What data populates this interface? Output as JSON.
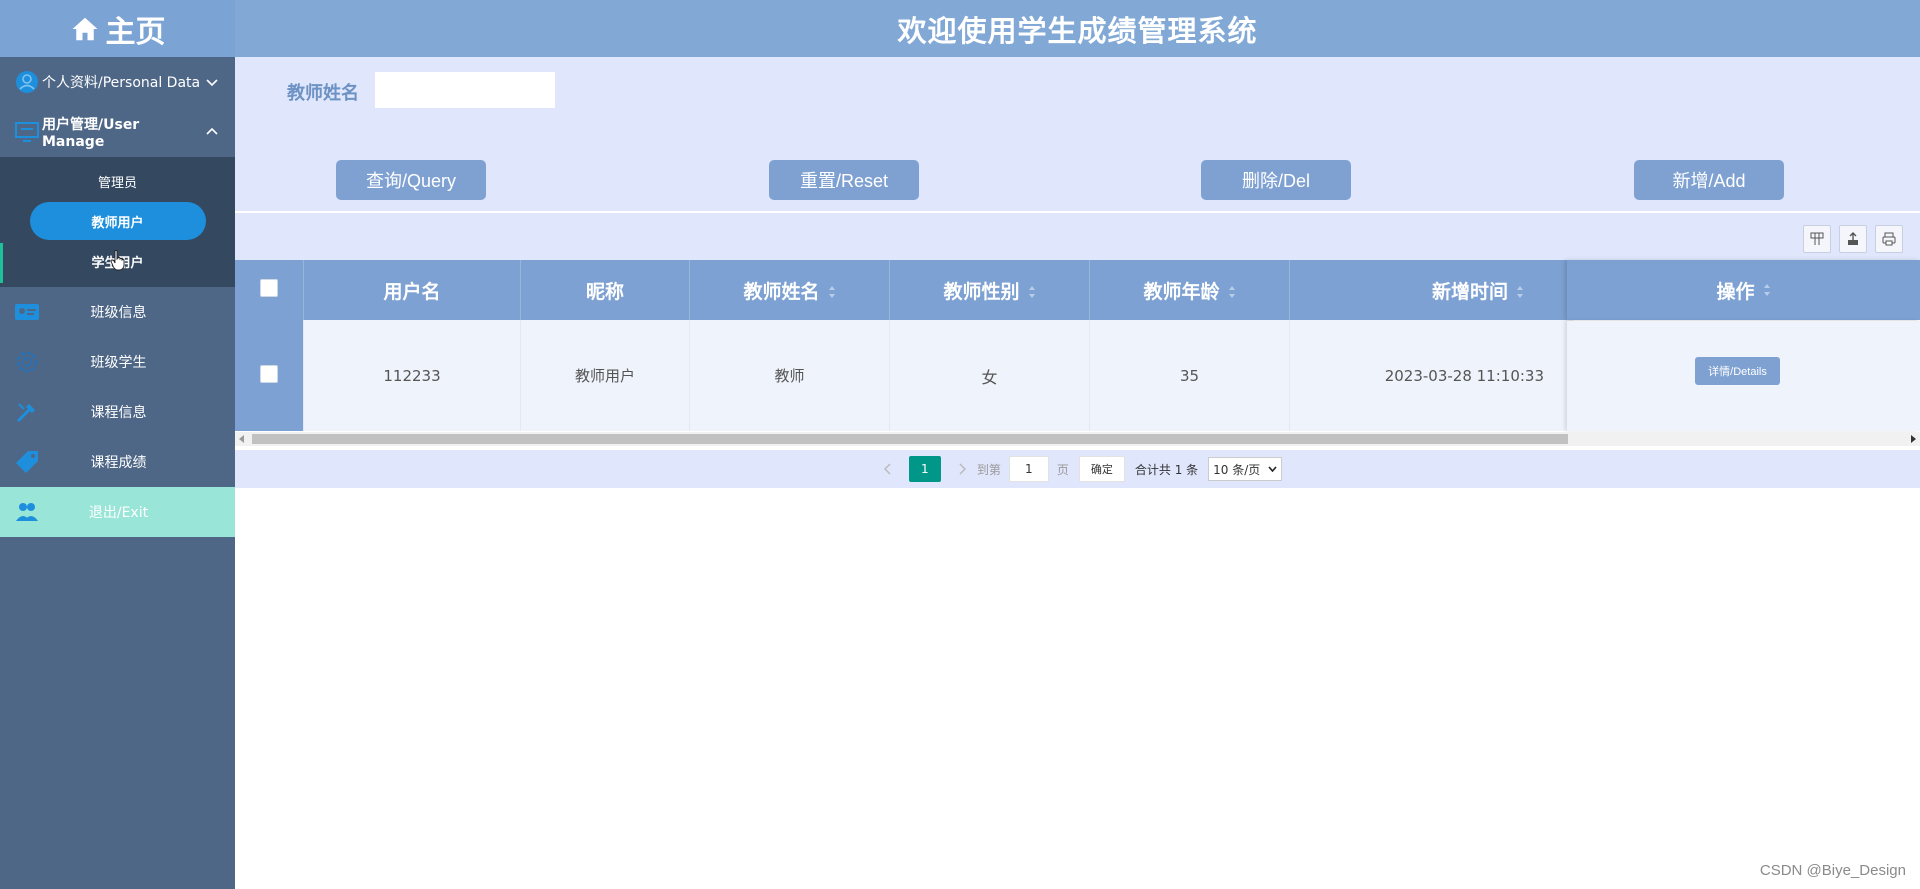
{
  "sidebar": {
    "header_title": "主页",
    "items": [
      {
        "label": "个人资料/Personal Data",
        "icon": "user-circle-icon"
      },
      {
        "label": "用户管理/User Manage",
        "icon": "monitor-icon"
      },
      {
        "label": "班级信息",
        "icon": "id-card-icon"
      },
      {
        "label": "班级学生",
        "icon": "gear-icon"
      },
      {
        "label": "课程信息",
        "icon": "tools-icon"
      },
      {
        "label": "课程成绩",
        "icon": "tag-icon"
      },
      {
        "label": "退出/Exit",
        "icon": "users-icon"
      }
    ],
    "submenu": [
      {
        "label": "管理员"
      },
      {
        "label": "教师用户"
      },
      {
        "label": "学生用户"
      }
    ]
  },
  "header": {
    "title": "欢迎使用学生成绩管理系统"
  },
  "search": {
    "label": "教师姓名",
    "value": ""
  },
  "actions": {
    "query": "查询/Query",
    "reset": "重置/Reset",
    "delete": "删除/Del",
    "add": "新增/Add"
  },
  "table": {
    "columns": [
      "用户名",
      "昵称",
      "教师姓名",
      "教师性别",
      "教师年龄",
      "新增时间",
      "操作"
    ],
    "rows": [
      {
        "username": "112233",
        "nickname": "教师用户",
        "name": "教师",
        "gender": "女",
        "age": "35",
        "created": "2023-03-28 11:10:33",
        "action": "详情/Details"
      }
    ]
  },
  "pager": {
    "current": "1",
    "goto_label": "到第",
    "goto_value": "1",
    "page_unit": "页",
    "confirm": "确定",
    "total": "合计共 1 条",
    "page_size": "10 条/页"
  },
  "watermark": "CSDN @Biye_Design",
  "colors": {
    "sidebar_bg": "#4f6787",
    "header_bg": "#82a8d6",
    "panel_bg": "#e0e6fc",
    "button_bg": "#7fa1d2",
    "active_pill": "#1e8fdc",
    "exit_bg": "#99e6d8",
    "pager_current": "#009688"
  }
}
